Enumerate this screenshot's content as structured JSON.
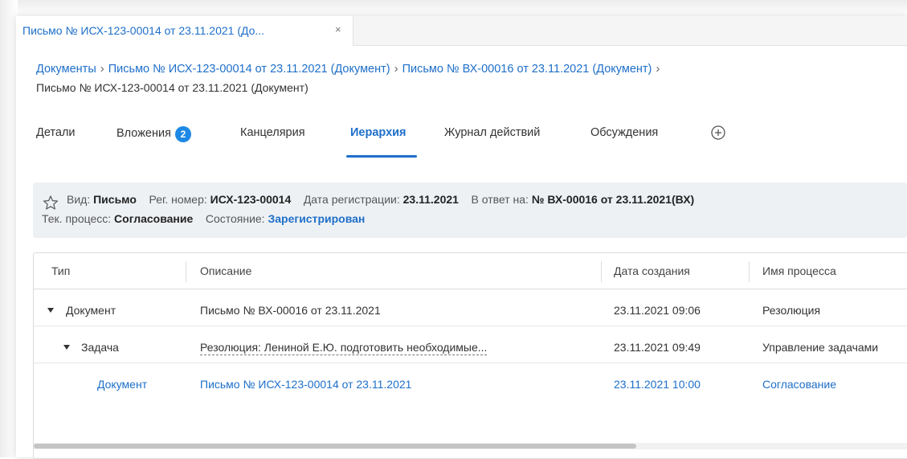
{
  "window": {
    "tab_title": "Письмо № ИСХ-123-00014 от 23.11.2021 (До...",
    "tab_close": "×"
  },
  "breadcrumb": {
    "items": [
      "Документы",
      "Письмо № ИСХ-123-00014 от 23.11.2021 (Документ)",
      "Письмо № ВХ-00016 от 23.11.2021 (Документ)"
    ],
    "separator": "›",
    "current": "Письмо № ИСХ-123-00014 от 23.11.2021 (Документ)"
  },
  "tabs": [
    {
      "label": "Детали"
    },
    {
      "label": "Вложения",
      "badge": "2"
    },
    {
      "label": "Канцелярия"
    },
    {
      "label": "Иерархия",
      "active": true
    },
    {
      "label": "Журнал действий"
    },
    {
      "label": "Обсуждения"
    }
  ],
  "info": {
    "kind_label": "Вид:",
    "kind_value": "Письмо",
    "reg_label": "Рег. номер:",
    "reg_value": "ИСХ-123-00014",
    "date_label": "Дата регистрации:",
    "date_value": "23.11.2021",
    "reply_label": "В ответ на:",
    "reply_value": "№ ВХ-00016 от 23.11.2021(ВХ)",
    "process_label": "Тек. процесс:",
    "process_value": "Согласование",
    "state_label": "Состояние:",
    "state_value": "Зарегистрирован"
  },
  "grid": {
    "columns": [
      "Тип",
      "Описание",
      "Дата создания",
      "Имя процесса"
    ],
    "rows": [
      {
        "type": "Документ",
        "description": "Письмо № ВХ-00016 от 23.11.2021",
        "created": "23.11.2021 09:06",
        "process": "Резолюция"
      },
      {
        "type": "Задача",
        "description": "Резолюция: Лениной Е.Ю. подготовить необходимые...",
        "created": "23.11.2021 09:49",
        "process": "Управление задачами"
      },
      {
        "type": "Документ",
        "description": "Письмо № ИСХ-123-00014 от 23.11.2021",
        "created": "23.11.2021 10:00",
        "process": "Согласование"
      }
    ]
  },
  "colors": {
    "accent": "#1e6fc9",
    "badge": "#1e88e5",
    "info_bg": "#eef1f4"
  },
  "icons": {
    "star": "star-outline-icon",
    "add_tab": "plus-circle-icon",
    "expand": "caret-down-icon",
    "close": "close-icon"
  }
}
